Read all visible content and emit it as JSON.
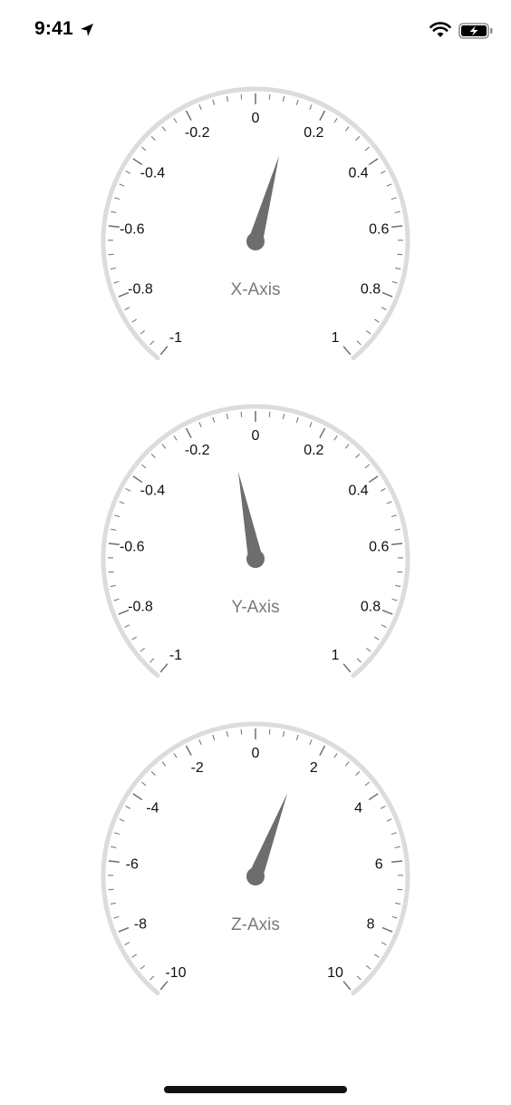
{
  "status_bar": {
    "time": "9:41",
    "icons": [
      "location-arrow-icon",
      "wifi-icon",
      "battery-charging-icon"
    ]
  },
  "colors": {
    "arc": "#dcdcdc",
    "needle": "#6b6e6b",
    "tick": "#6e6e6e",
    "title": "#7a7a7a",
    "text": "#111111"
  },
  "gauges": [
    {
      "id": "x",
      "title": "X-Axis",
      "min": -1,
      "max": 1,
      "labels": [
        {
          "value": -1,
          "text": "-1"
        },
        {
          "value": -0.8,
          "text": "-0.8"
        },
        {
          "value": -0.6,
          "text": "-0.6"
        },
        {
          "value": -0.4,
          "text": "-0.4"
        },
        {
          "value": -0.2,
          "text": "-0.2"
        },
        {
          "value": 0,
          "text": "0"
        },
        {
          "value": 0.2,
          "text": "0.2"
        },
        {
          "value": 0.4,
          "text": "0.4"
        },
        {
          "value": 0.6,
          "text": "0.6"
        },
        {
          "value": 0.8,
          "text": "0.8"
        },
        {
          "value": 1,
          "text": "1"
        }
      ],
      "value": 0.11
    },
    {
      "id": "y",
      "title": "Y-Axis",
      "min": -1,
      "max": 1,
      "labels": [
        {
          "value": -1,
          "text": "-1"
        },
        {
          "value": -0.8,
          "text": "-0.8"
        },
        {
          "value": -0.6,
          "text": "-0.6"
        },
        {
          "value": -0.4,
          "text": "-0.4"
        },
        {
          "value": -0.2,
          "text": "-0.2"
        },
        {
          "value": 0,
          "text": "0"
        },
        {
          "value": 0.2,
          "text": "0.2"
        },
        {
          "value": 0.4,
          "text": "0.4"
        },
        {
          "value": 0.6,
          "text": "0.6"
        },
        {
          "value": 0.8,
          "text": "0.8"
        },
        {
          "value": 1,
          "text": "1"
        }
      ],
      "value": -0.08
    },
    {
      "id": "z",
      "title": "Z-Axis",
      "min": -10,
      "max": 10,
      "labels": [
        {
          "value": -10,
          "text": "-10"
        },
        {
          "value": -8,
          "text": "-8"
        },
        {
          "value": -6,
          "text": "-6"
        },
        {
          "value": -4,
          "text": "-4"
        },
        {
          "value": -2,
          "text": "-2"
        },
        {
          "value": 0,
          "text": "0"
        },
        {
          "value": 2,
          "text": "2"
        },
        {
          "value": 4,
          "text": "4"
        },
        {
          "value": 6,
          "text": "6"
        },
        {
          "value": 8,
          "text": "8"
        },
        {
          "value": 10,
          "text": "10"
        }
      ],
      "value": 1.5
    }
  ]
}
